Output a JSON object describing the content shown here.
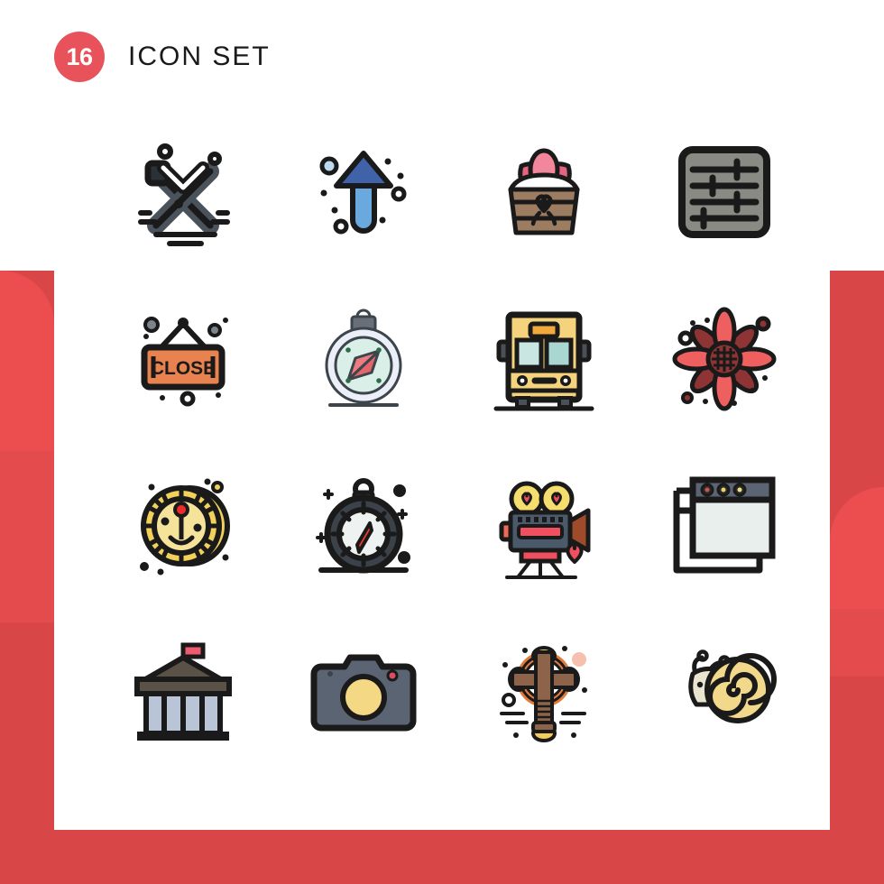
{
  "header": {
    "count": "16",
    "title": "ICON SET"
  },
  "theme": {
    "brand_red": "#e8525a",
    "deco_red_light": "#ec4e50",
    "deco_red_mid": "#e34b4d",
    "deco_red_dark": "#d94648",
    "card_background": "#ffffff",
    "outline": "#1a1a1a"
  },
  "grid": {
    "columns": 4,
    "rows": 4,
    "total": 16
  },
  "icons": [
    {
      "index": 1,
      "name": "crossed-hockey-sticks-icon",
      "label": "Crossed Sticks",
      "row": 1,
      "col": 1,
      "primary_color": "#4a525c",
      "accent_color": "#2b3138"
    },
    {
      "index": 2,
      "name": "up-arrow-rocket-icon",
      "label": "Up Arrow",
      "row": 1,
      "col": 2,
      "primary_color": "#6aa9dd",
      "accent_color": "#3f62a8"
    },
    {
      "index": 3,
      "name": "easter-basket-icon",
      "label": "Easter Basket",
      "row": 1,
      "col": 3,
      "primary_color": "#9d7d62",
      "accent_color": "#f2879b"
    },
    {
      "index": 4,
      "name": "settings-sliders-icon",
      "label": "Settings",
      "row": 1,
      "col": 4,
      "primary_color": "#8a8a84",
      "accent_color": "#1a1a1a"
    },
    {
      "index": 5,
      "name": "close-sign-icon",
      "label": "Close Sign",
      "row": 2,
      "col": 1,
      "primary_color": "#e8824f",
      "accent_color": "#1a1a1a",
      "text": "CLOSE"
    },
    {
      "index": 6,
      "name": "compass-light-icon",
      "label": "Compass",
      "row": 2,
      "col": 2,
      "primary_color": "#e6f2ee",
      "accent_color": "#e3666c"
    },
    {
      "index": 7,
      "name": "school-bus-icon",
      "label": "School Bus",
      "row": 2,
      "col": 3,
      "primary_color": "#f5d27c",
      "accent_color": "#c9e6e2"
    },
    {
      "index": 8,
      "name": "flower-icon",
      "label": "Flower",
      "row": 2,
      "col": 4,
      "primary_color": "#ee5f5f",
      "accent_color": "#8e3434"
    },
    {
      "index": 9,
      "name": "roulette-wheel-icon",
      "label": "Roulette",
      "row": 3,
      "col": 1,
      "primary_color": "#f2d15a",
      "accent_color": "#ee2b2b"
    },
    {
      "index": 10,
      "name": "compass-dark-icon",
      "label": "Compass Dark",
      "row": 3,
      "col": 2,
      "primary_color": "#3b4249",
      "accent_color": "#ee3b32"
    },
    {
      "index": 11,
      "name": "movie-camera-heart-icon",
      "label": "Movie Camera",
      "row": 3,
      "col": 3,
      "primary_color": "#4a5a6b",
      "accent_color": "#ef4f5e"
    },
    {
      "index": 12,
      "name": "browser-windows-icon",
      "label": "Browser Window",
      "row": 3,
      "col": 4,
      "primary_color": "#e8efec",
      "accent_color": "#5b6472"
    },
    {
      "index": 13,
      "name": "bank-building-icon",
      "label": "Bank",
      "row": 4,
      "col": 1,
      "primary_color": "#b9c4d6",
      "accent_color": "#5a5147"
    },
    {
      "index": 14,
      "name": "camera-icon",
      "label": "Camera",
      "row": 4,
      "col": 2,
      "primary_color": "#5b6472",
      "accent_color": "#f5d884"
    },
    {
      "index": 15,
      "name": "celtic-cross-icon",
      "label": "Celtic Cross",
      "row": 4,
      "col": 3,
      "primary_color": "#8d6449",
      "accent_color": "#e8a14a"
    },
    {
      "index": 16,
      "name": "snail-icon",
      "label": "Snail",
      "row": 4,
      "col": 4,
      "primary_color": "#f2d88a",
      "accent_color": "#1a1a1a"
    }
  ]
}
